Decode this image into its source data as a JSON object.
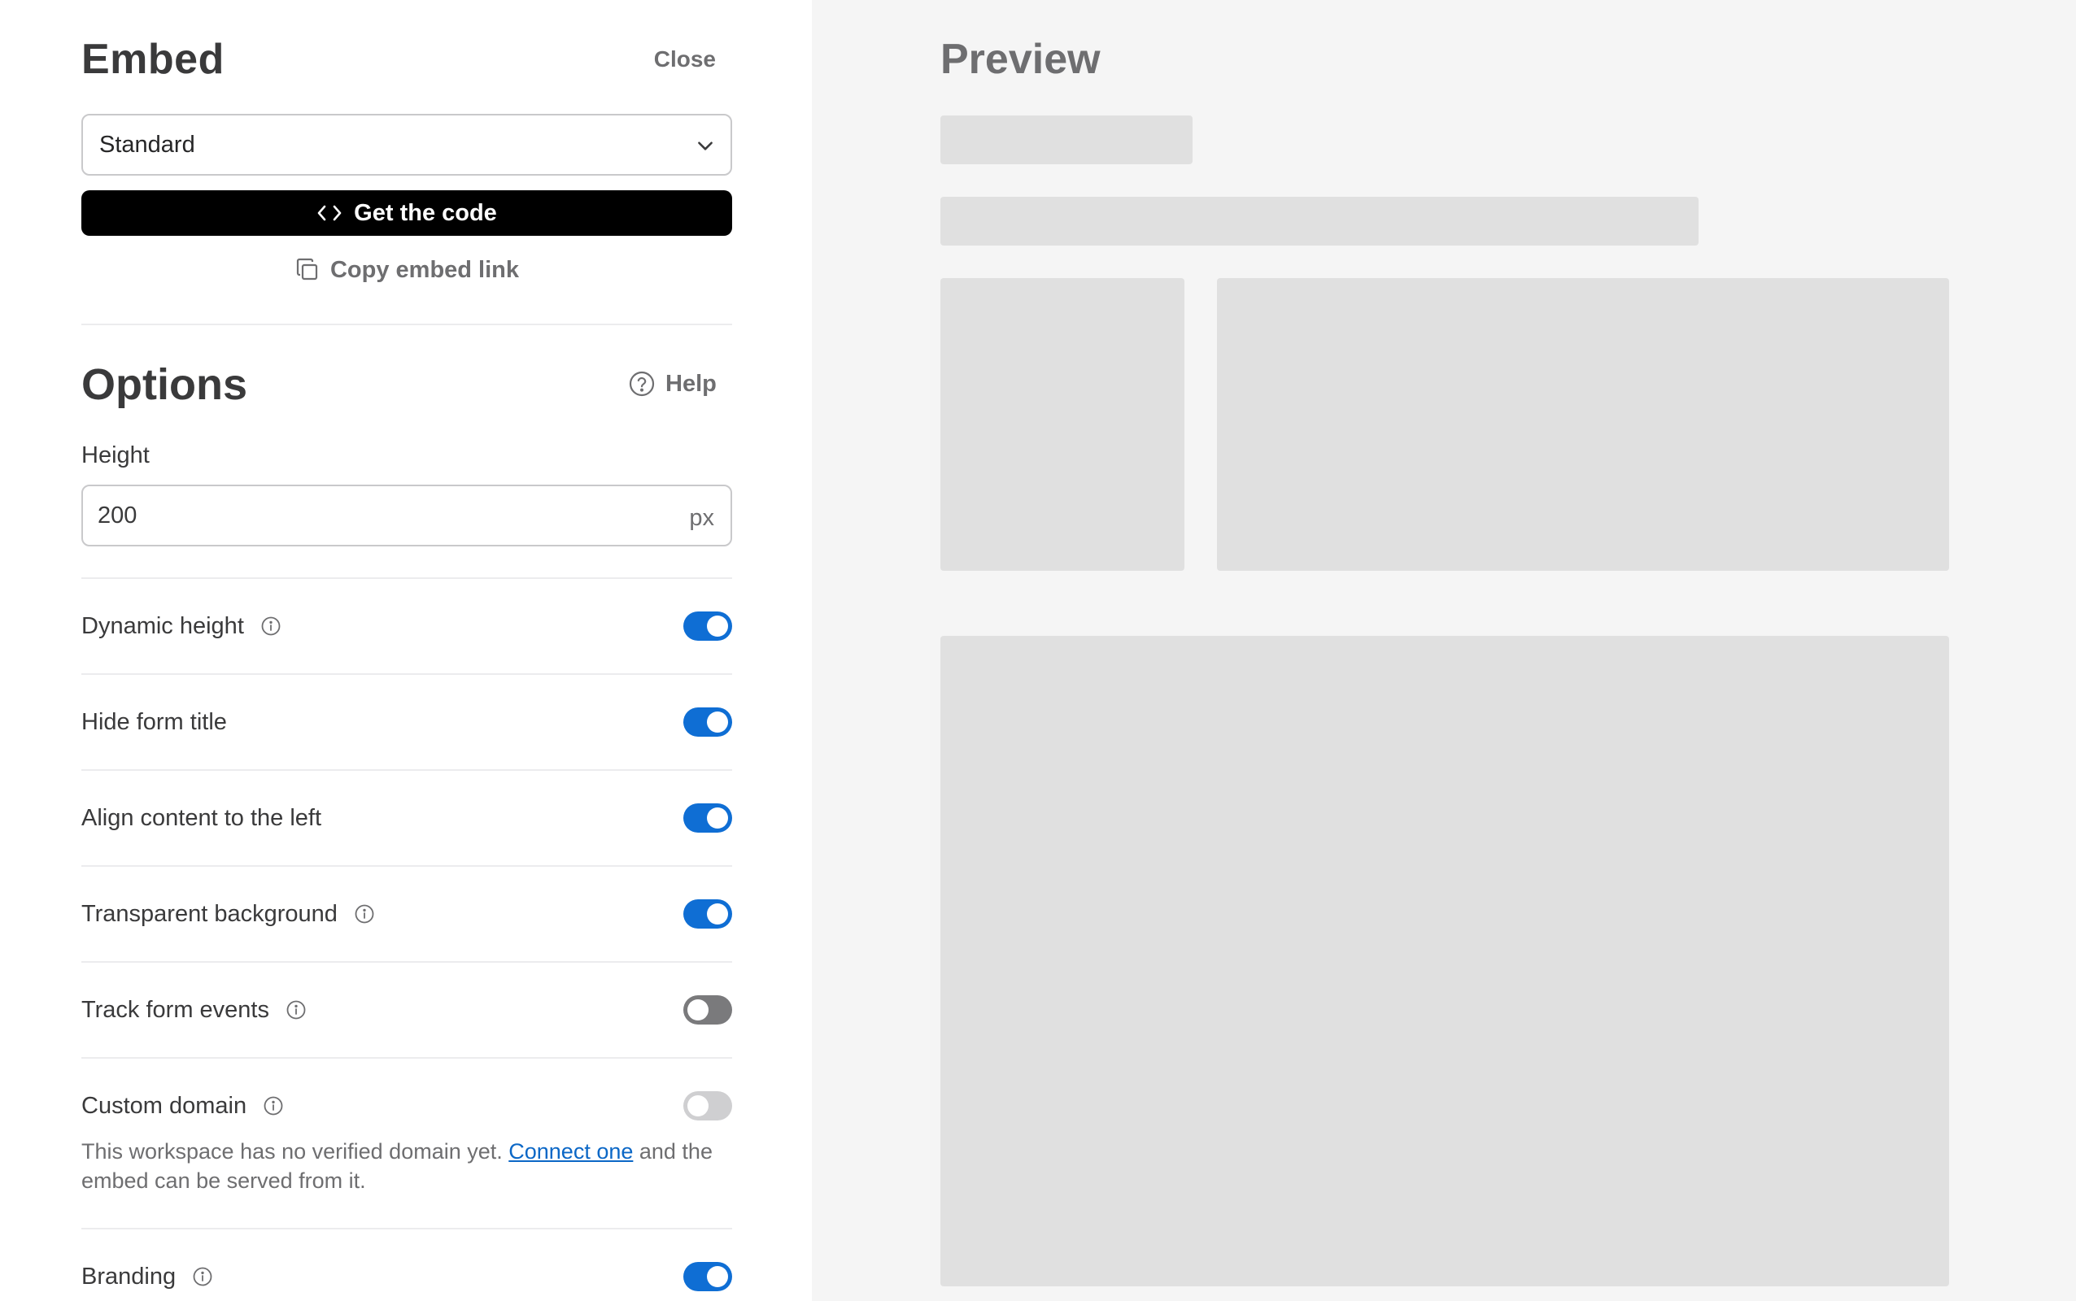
{
  "embed": {
    "title": "Embed",
    "close_label": "Close",
    "type_select": {
      "value": "Standard",
      "icon": "chevron-down-icon"
    },
    "get_code_label": "Get the code",
    "copy_link_label": "Copy embed link"
  },
  "options": {
    "title": "Options",
    "help_label": "Help",
    "height": {
      "label": "Height",
      "value": "200",
      "unit": "px"
    },
    "toggles": [
      {
        "label": "Dynamic height",
        "info": true,
        "state": "on"
      },
      {
        "label": "Hide form title",
        "info": false,
        "state": "on"
      },
      {
        "label": "Align content to the left",
        "info": false,
        "state": "on"
      },
      {
        "label": "Transparent background",
        "info": true,
        "state": "on"
      },
      {
        "label": "Track form events",
        "info": true,
        "state": "off"
      },
      {
        "label": "Custom domain",
        "info": true,
        "state": "disabled"
      },
      {
        "label": "Branding",
        "info": true,
        "state": "on"
      }
    ],
    "custom_domain_note": {
      "before": "This workspace has no verified domain yet. ",
      "link": "Connect one",
      "after": " and the embed can be served from it."
    }
  },
  "preview": {
    "title": "Preview"
  },
  "colors": {
    "accent": "#0f6ed4",
    "preview_bg": "#f5f5f5",
    "skeleton": "#e0e0e0",
    "button_bg": "#000000"
  }
}
